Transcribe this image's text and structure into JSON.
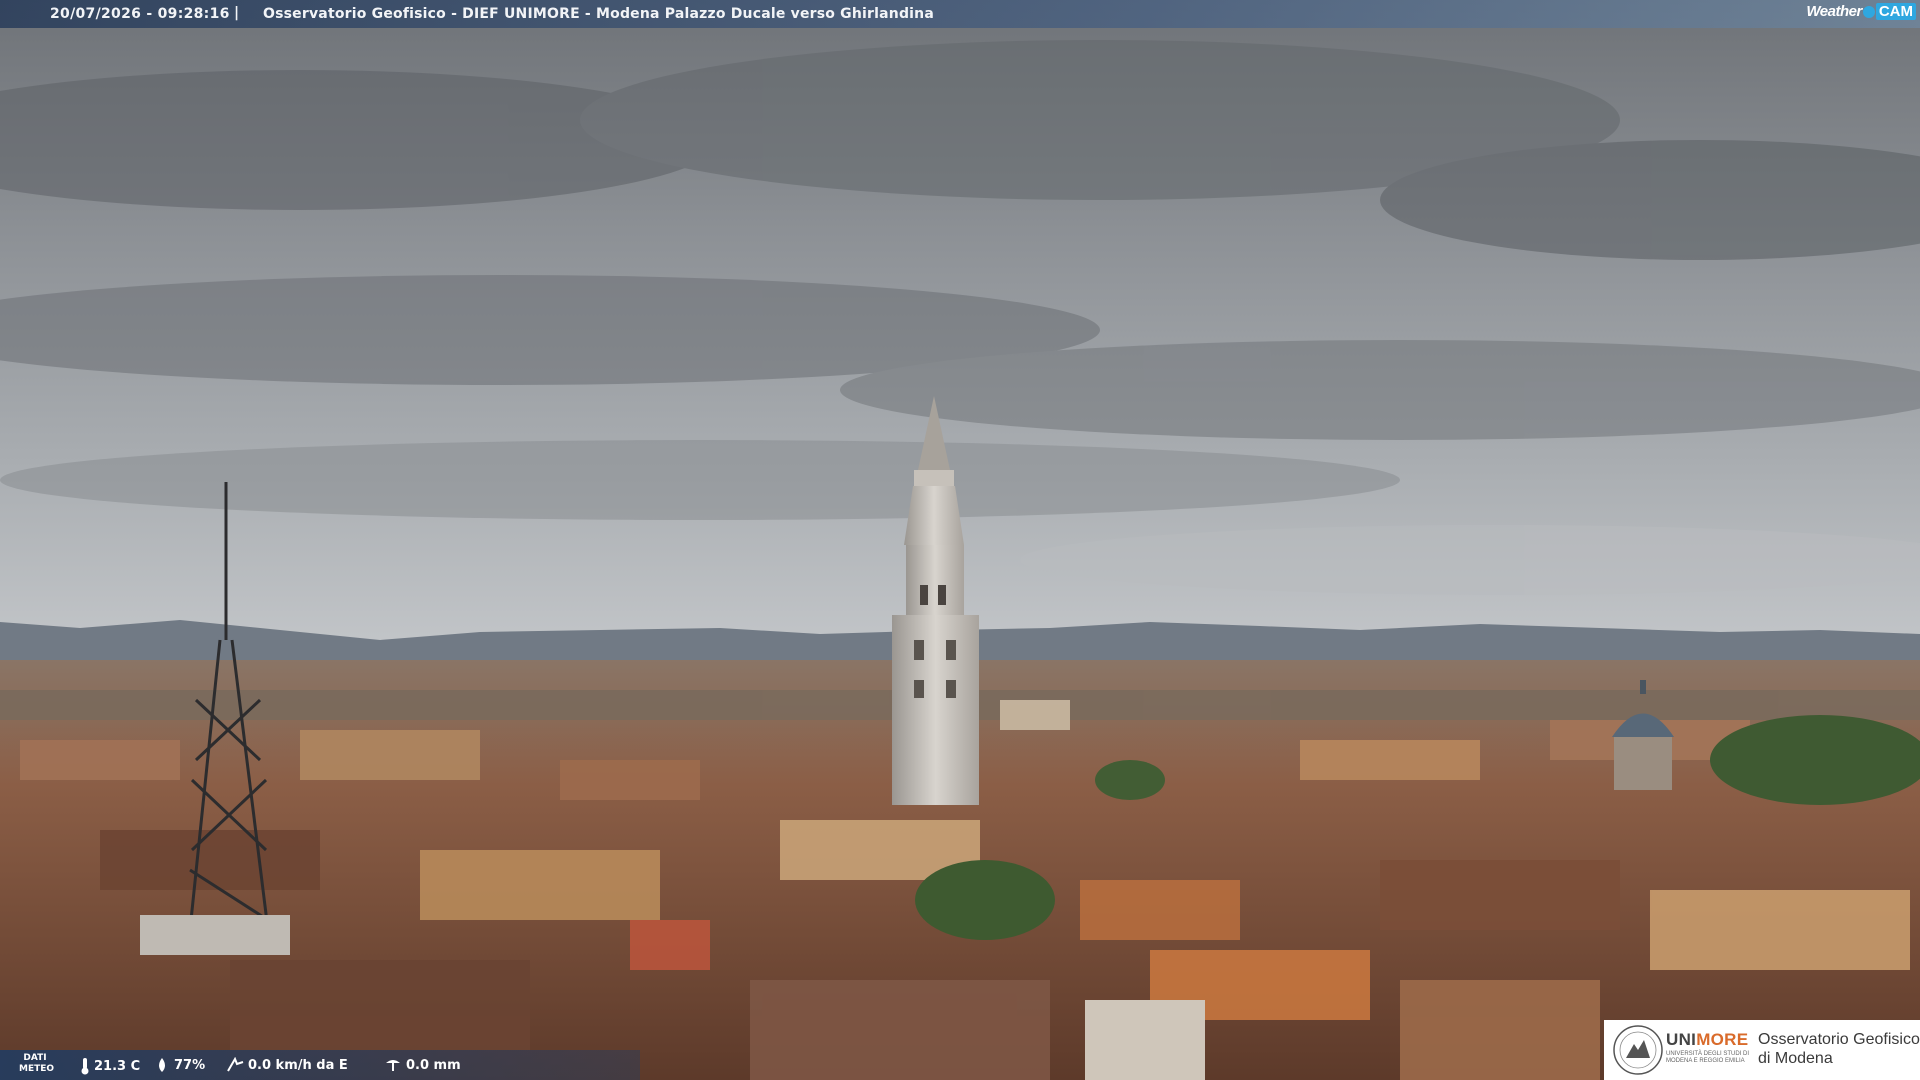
{
  "header": {
    "timestamp": "20/07/2026 - 09:28:16",
    "separator": "|",
    "title": "Osservatorio Geofisico - DIEF UNIMORE - Modena Palazzo Ducale verso Ghirlandina"
  },
  "brand_logo": {
    "part1": "Weather",
    "part2": "CAM",
    "accent": "#2fa7e0"
  },
  "meteo": {
    "label_line1": "DATI",
    "label_line2": "METEO",
    "temperature": "21.3 C",
    "humidity": "77%",
    "wind": "0.0 km/h da E",
    "rain": "0.0 mm",
    "icons": [
      "thermometer-icon",
      "humidity-drop-icon",
      "wind-icon",
      "rain-icon"
    ]
  },
  "institution": {
    "name_part1": "UNI",
    "name_part2": "MORE",
    "subtitle": "UNIVERSITÀ DEGLI STUDI DI MODENA E REGGIO EMILIA",
    "observatory_line1": "Osservatorio Geofisico",
    "observatory_line2": "di Modena",
    "accent": "#d96b2b"
  }
}
